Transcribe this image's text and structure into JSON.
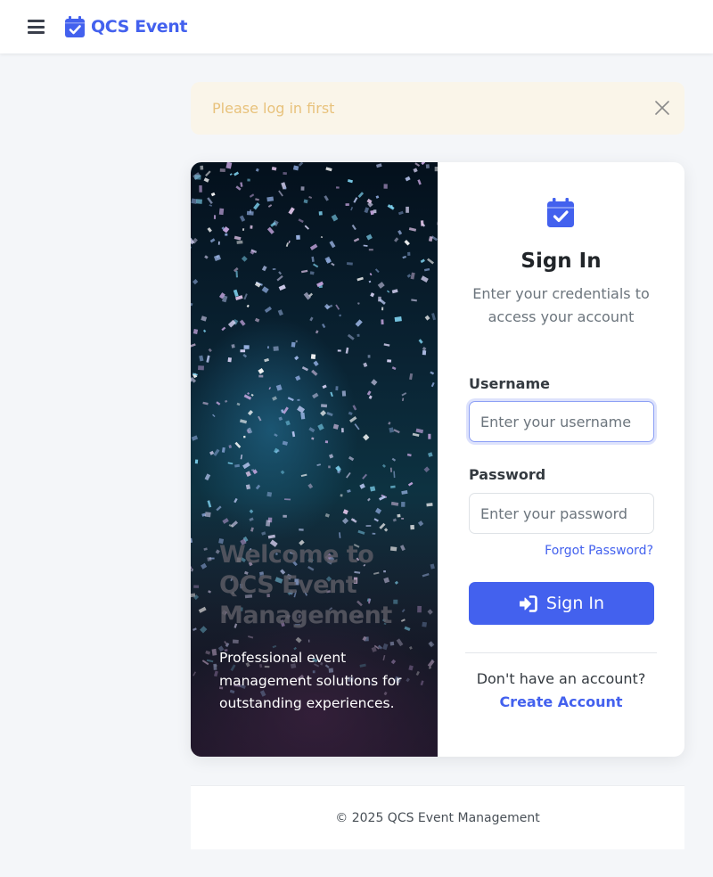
{
  "topbar": {
    "brand_name": "QCS Event",
    "menu_icon": "hamburger-menu-icon",
    "brand_icon": "calendar-check-icon",
    "brand_color": "#4361ee"
  },
  "alert": {
    "message": "Please log in first",
    "close_icon": "close-icon",
    "background": "#faf5e9",
    "text_color": "#e8c27c"
  },
  "hero": {
    "title": "Welcome to\nQCS Event\nManagement",
    "subtitle": "Professional event management solutions for outstanding experiences.",
    "image": "concert-confetti-photo"
  },
  "login": {
    "icon": "calendar-check-icon",
    "title": "Sign In",
    "subtitle": "Enter your credentials to access your account",
    "username_label": "Username",
    "username_placeholder": "Enter your username",
    "username_value": "",
    "password_label": "Password",
    "password_placeholder": "Enter your password",
    "password_value": "",
    "forgot_label": "Forgot Password?",
    "submit_label": "Sign In",
    "submit_icon": "sign-in-arrow-icon",
    "no_account_text": "Don't have an account?",
    "create_label": "Create Account",
    "accent_color": "#4361ee"
  },
  "footer": {
    "copyright": "© 2025 QCS Event Management"
  }
}
